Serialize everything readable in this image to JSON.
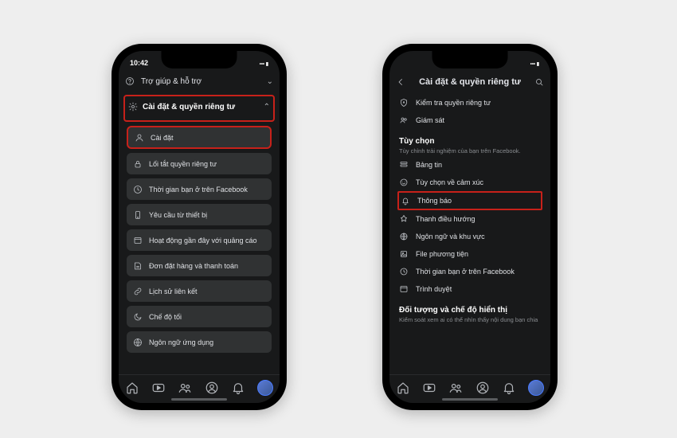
{
  "status": {
    "time_left": "10:42",
    "time_right": "—"
  },
  "left": {
    "help_label": "Trợ giúp & hỗ trợ",
    "settings_privacy_label": "Cài đặt & quyền riêng tư",
    "items": [
      {
        "label": "Cài đặt"
      },
      {
        "label": "Lối tắt quyền riêng tư"
      },
      {
        "label": "Thời gian bạn ở trên Facebook"
      },
      {
        "label": "Yêu cầu từ thiết bị"
      },
      {
        "label": "Hoạt động gần đây với quảng cáo"
      },
      {
        "label": "Đơn đặt hàng và thanh toán"
      },
      {
        "label": "Lịch sử liên kết"
      },
      {
        "label": "Chế độ tối"
      },
      {
        "label": "Ngôn ngữ ứng dụng"
      }
    ]
  },
  "right": {
    "title": "Cài đặt & quyền riêng tư",
    "top_items": [
      {
        "label": "Kiểm tra quyền riêng tư"
      },
      {
        "label": "Giám sát"
      }
    ],
    "section1": {
      "title": "Tùy chọn",
      "subtitle": "Tùy chỉnh trải nghiệm của bạn trên Facebook."
    },
    "opt_items": [
      {
        "label": "Bảng tin"
      },
      {
        "label": "Tùy chọn về cảm xúc"
      },
      {
        "label": "Thông báo"
      },
      {
        "label": "Thanh điều hướng"
      },
      {
        "label": "Ngôn ngữ và khu vực"
      },
      {
        "label": "File phương tiện"
      },
      {
        "label": "Thời gian bạn ở trên Facebook"
      },
      {
        "label": "Trình duyệt"
      }
    ],
    "section2": {
      "title": "Đối tượng và chế độ hiển thị",
      "subtitle": "Kiểm soát xem ai có thể nhìn thấy nội dung bạn chia"
    }
  }
}
